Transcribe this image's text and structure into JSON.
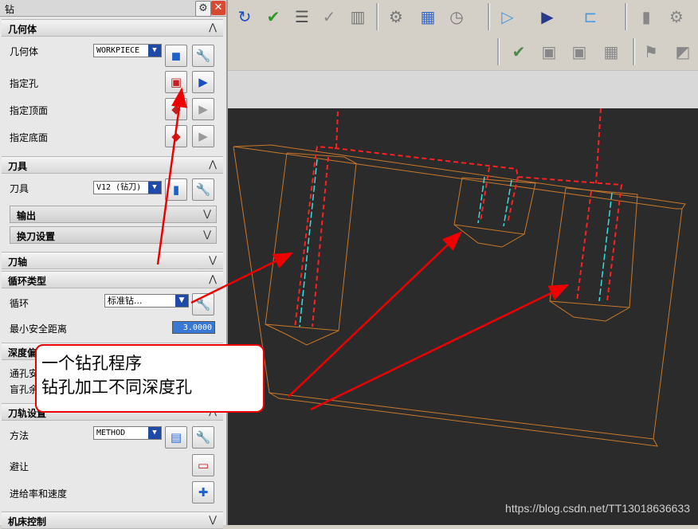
{
  "dialog": {
    "title": "钻",
    "sections": {
      "geometry": "几何体",
      "tool": "刀具",
      "axis": "刀轴",
      "cycle": "循环类型",
      "depth": "深度偏",
      "path": "刀轨设置",
      "machine": "机床控制"
    },
    "rows": {
      "geometry_label": "几何体",
      "geometry_value": "WORKPIECE",
      "hole_label": "指定孔",
      "top_label": "指定顶面",
      "bottom_label": "指定底面",
      "tool_label": "刀具",
      "tool_value": "V12 (钻刀)",
      "output_label": "输出",
      "toolchange_label": "换刀设置",
      "cycle_label": "循环",
      "cycle_value": "标准钻...",
      "clearance_label": "最小安全距离",
      "clearance_value": "3.0000",
      "through_label": "通孔安",
      "blind_label": "盲孔余",
      "method_label": "方法",
      "method_value": "METHOD",
      "avoid_label": "避让",
      "feeds_label": "进给率和速度"
    }
  },
  "annotation": {
    "line1": "一个钻孔程序",
    "line2": "钻孔加工不同深度孔"
  },
  "watermark": "https://blog.csdn.net/TT13018636633",
  "colors": {
    "model": "#c8782a",
    "toolpath": "#ff2020",
    "centerline": "#30e0e0",
    "arrow": "#ee0000"
  }
}
